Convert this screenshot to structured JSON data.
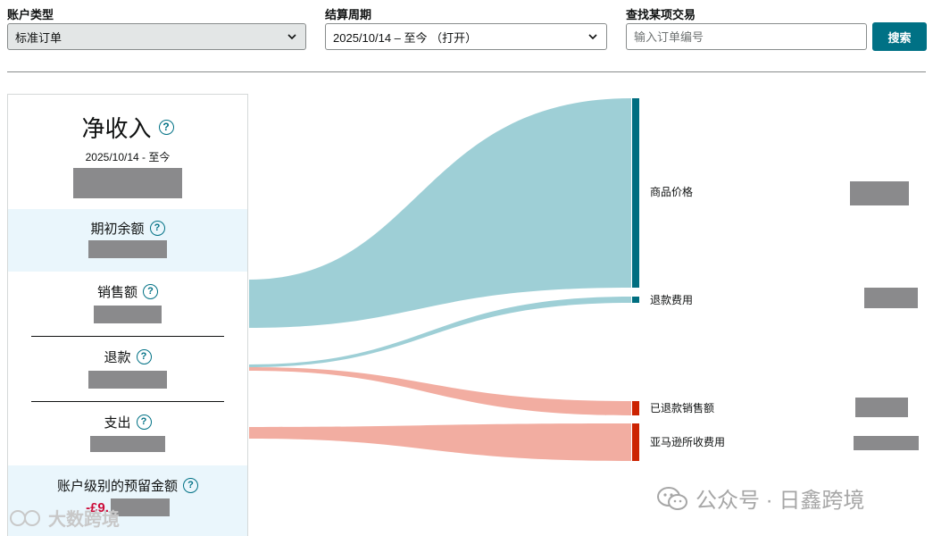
{
  "filters": {
    "account_type": {
      "label": "账户类型",
      "value": "标准订单"
    },
    "period": {
      "label": "结算周期",
      "value": "2025/10/14 – 至今 （打开）"
    },
    "search": {
      "label": "查找某项交易",
      "placeholder": "输入订单编号",
      "button": "搜索"
    }
  },
  "summary": {
    "net": {
      "title": "净收入",
      "date": "2025/10/14 - 至今"
    },
    "opening": {
      "title": "期初余额"
    },
    "sales": {
      "title": "销售额"
    },
    "refunds": {
      "title": "退款"
    },
    "expenses": {
      "title": "支出"
    },
    "reserve": {
      "title": "账户级别的预留金额",
      "amount_prefix": "-£9."
    }
  },
  "sankey_nodes": [
    {
      "label": "商品价格",
      "color": "#006e80"
    },
    {
      "label": "退款费用",
      "color": "#006e80"
    },
    {
      "label": "已退款销售额",
      "color": "#cc2200"
    },
    {
      "label": "亚马逊所收费用",
      "color": "#cc2200"
    }
  ],
  "colors": {
    "teal_flow": "#9ecfd6",
    "salmon_flow": "#f2ada1",
    "button": "#007185"
  },
  "watermark": {
    "right": "公众号 · 日鑫跨境",
    "left": "大数跨境"
  }
}
